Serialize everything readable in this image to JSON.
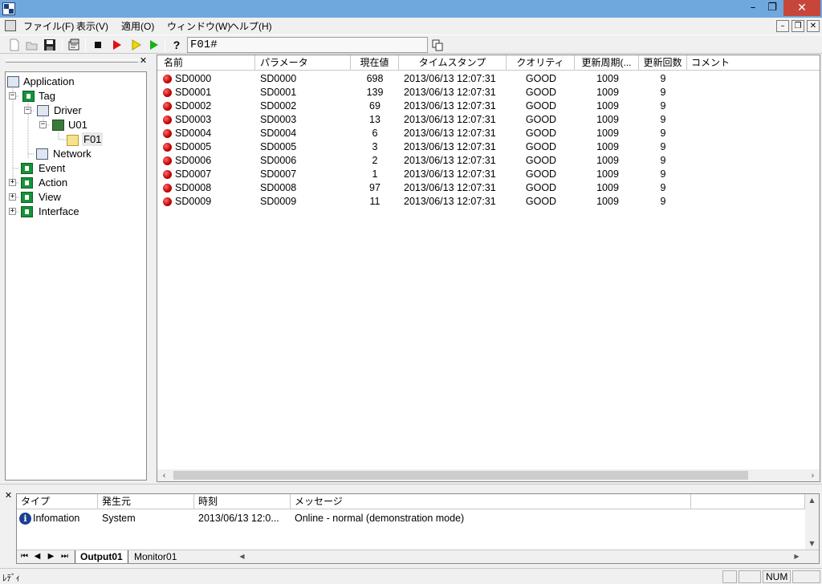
{
  "titlebar": {
    "min_glyph": "–",
    "max_glyph": "❐",
    "close_glyph": "✕"
  },
  "menubar": {
    "items": [
      "ファイル(F)",
      "表示(V)",
      "適用(O)",
      "ウィンドウ(W)",
      "ヘルプ(H)"
    ],
    "mdi_min": "–",
    "mdi_restore": "❐",
    "mdi_close": "✕"
  },
  "toolbar": {
    "address_value": "F01#",
    "help_glyph": "?"
  },
  "tree": {
    "close_glyph": "✕",
    "expand_minus": "−",
    "expand_plus": "+",
    "nodes": [
      "Application",
      "Tag",
      "Driver",
      "U01",
      "F01",
      "Network",
      "Event",
      "Action",
      "View",
      "Interface"
    ]
  },
  "list": {
    "columns": [
      "名前",
      "パラメータ",
      "現在値",
      "タイムスタンプ",
      "クオリティ",
      "更新周期(...",
      "更新回数",
      "コメント"
    ],
    "rows": [
      [
        "SD0000",
        "SD0000",
        "698",
        "2013/06/13 12:07:31",
        "GOOD",
        "1009",
        "9"
      ],
      [
        "SD0001",
        "SD0001",
        "139",
        "2013/06/13 12:07:31",
        "GOOD",
        "1009",
        "9"
      ],
      [
        "SD0002",
        "SD0002",
        "69",
        "2013/06/13 12:07:31",
        "GOOD",
        "1009",
        "9"
      ],
      [
        "SD0003",
        "SD0003",
        "13",
        "2013/06/13 12:07:31",
        "GOOD",
        "1009",
        "9"
      ],
      [
        "SD0004",
        "SD0004",
        "6",
        "2013/06/13 12:07:31",
        "GOOD",
        "1009",
        "9"
      ],
      [
        "SD0005",
        "SD0005",
        "3",
        "2013/06/13 12:07:31",
        "GOOD",
        "1009",
        "9"
      ],
      [
        "SD0006",
        "SD0006",
        "2",
        "2013/06/13 12:07:31",
        "GOOD",
        "1009",
        "9"
      ],
      [
        "SD0007",
        "SD0007",
        "1",
        "2013/06/13 12:07:31",
        "GOOD",
        "1009",
        "9"
      ],
      [
        "SD0008",
        "SD0008",
        "97",
        "2013/06/13 12:07:31",
        "GOOD",
        "1009",
        "9"
      ],
      [
        "SD0009",
        "SD0009",
        "11",
        "2013/06/13 12:07:31",
        "GOOD",
        "1009",
        "9"
      ]
    ],
    "scroll_left": "‹",
    "scroll_right": "›"
  },
  "output": {
    "close_glyph": "✕",
    "columns": [
      "タイプ",
      "発生元",
      "時刻",
      "メッセージ"
    ],
    "row": {
      "type": "Infomation",
      "source": "System",
      "time": "2013/06/13 12:0...",
      "message": "Online - normal (demonstration mode)"
    },
    "info_glyph": "i",
    "scroll_up": "▲",
    "scroll_down": "▼",
    "nav_first": "⏮",
    "nav_prev": "◀",
    "nav_next": "▶",
    "nav_last": "⏭",
    "tabs": [
      "Output01",
      "Monitor01"
    ],
    "scroll_left": "◀",
    "scroll_right": "▶"
  },
  "statusbar": {
    "text": "ﾚﾃﾞｨ",
    "num": "NUM"
  }
}
